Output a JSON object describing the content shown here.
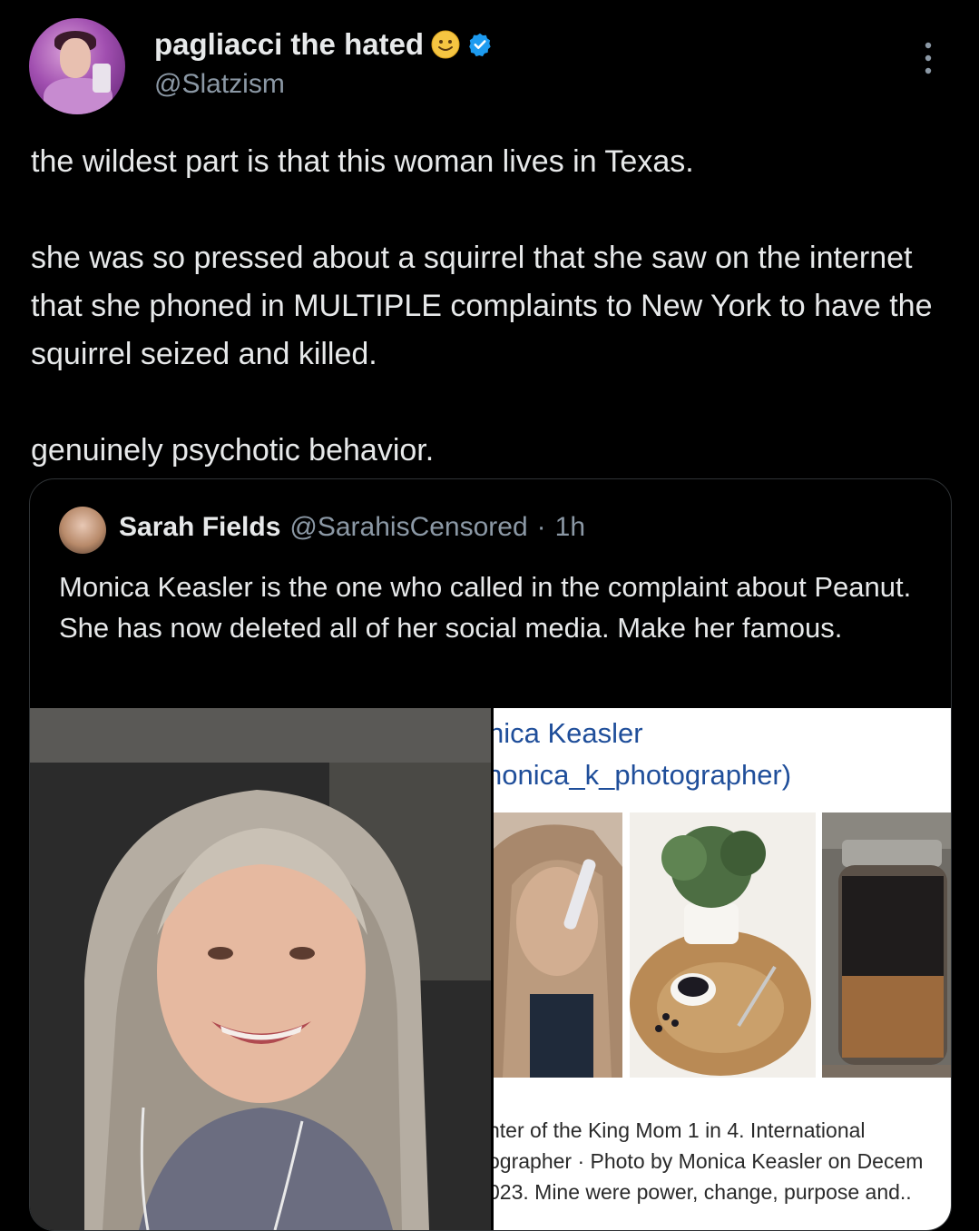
{
  "author": {
    "display_name": "pagliacci the hated",
    "handle": "@Slatzism",
    "emoji_icon": "smiling-face-emoji",
    "verified_icon": "verified-badge-icon",
    "verified_color": "#1d9bf0"
  },
  "tweet": {
    "paragraphs": [
      "the wildest part is that this woman lives in Texas.",
      "she was so pressed about a squirrel that she saw on the internet that she phoned in MULTIPLE complaints to New York to have the squirrel seized and killed.",
      "genuinely psychotic behavior."
    ]
  },
  "quoted": {
    "display_name": "Sarah Fields",
    "handle": "@SarahisCensored",
    "separator": "·",
    "time": "1h",
    "text": "Monica Keasler is the one who called in the complaint about Peanut. She has now deleted all of her social media. Make her famous.",
    "image_right": {
      "title_line1": "nica Keasler",
      "title_line2": "nonica_k_photographer)",
      "caption_line1": "hter of the King Mom 1 in 4. International",
      "caption_line2": "ographer · Photo by Monica Keasler on Decem",
      "caption_line3": "023. Mine were power, change, purpose and.."
    }
  },
  "colors": {
    "background": "#000000",
    "text_primary": "#e7e9ea",
    "text_secondary": "#8b98a5",
    "border": "#2f3336",
    "link_blue": "#1f4e9a"
  }
}
